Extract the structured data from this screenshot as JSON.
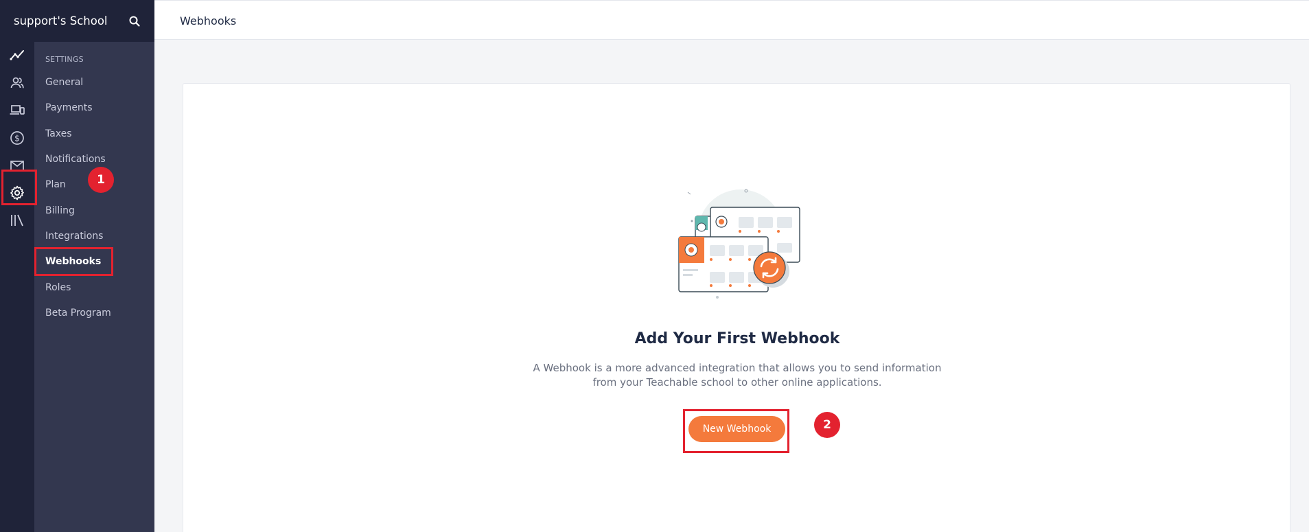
{
  "school": {
    "name": "support's School",
    "search_icon": "search-icon"
  },
  "rail": {
    "items": [
      {
        "icon": "analytics-icon"
      },
      {
        "icon": "users-icon"
      },
      {
        "icon": "devices-icon"
      },
      {
        "icon": "dollar-icon"
      },
      {
        "icon": "mail-icon"
      },
      {
        "icon": "gear-icon",
        "active": true
      },
      {
        "icon": "library-icon"
      }
    ]
  },
  "subnav": {
    "heading": "SETTINGS",
    "items": [
      {
        "label": "General"
      },
      {
        "label": "Payments"
      },
      {
        "label": "Taxes"
      },
      {
        "label": "Notifications"
      },
      {
        "label": "Plan"
      },
      {
        "label": "Billing"
      },
      {
        "label": "Integrations"
      },
      {
        "label": "Webhooks",
        "active": true
      },
      {
        "label": "Roles"
      },
      {
        "label": "Beta Program"
      }
    ]
  },
  "topbar": {
    "title": "Webhooks"
  },
  "empty_state": {
    "title": "Add Your First Webhook",
    "description": "A Webhook is a more advanced integration that allows you to send information from your Teachable school to other online applications.",
    "button_label": "New Webhook"
  },
  "annotations": {
    "badge1": "1",
    "badge2": "2",
    "highlight_color": "#e3222f"
  },
  "colors": {
    "accent": "#f47a3c",
    "sidebar_dark": "#1f2339",
    "sidebar": "#33374f"
  }
}
